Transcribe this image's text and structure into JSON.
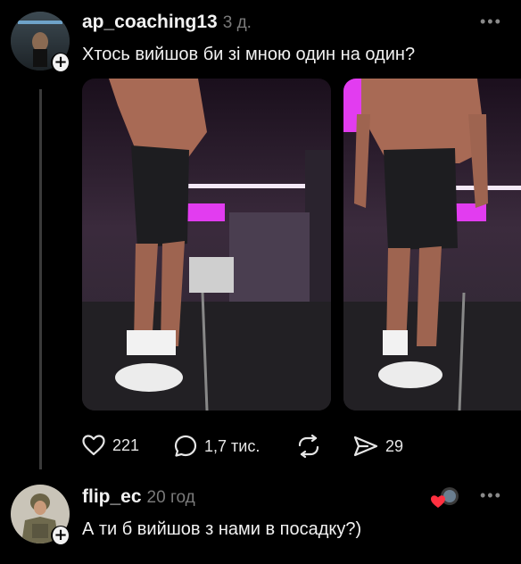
{
  "post": {
    "username": "ap_coaching13",
    "time": "3 д.",
    "text": "Хтось вийшов би зі мною один на один?",
    "more_icon": "more-horizontal-icon",
    "media": [
      "photo-1",
      "photo-2"
    ],
    "actions": {
      "likes": "221",
      "comments": "1,7 тис.",
      "repost_icon": "repost-icon",
      "shares": "29"
    }
  },
  "reply": {
    "username": "flip_ec",
    "time": "20 год",
    "text": "А ти б вийшов з нами в посадку?)",
    "liked_by_author_badge": "heart-avatar-icon",
    "more_icon": "more-horizontal-icon"
  },
  "colors": {
    "background": "#000000",
    "text": "#f2f2f2",
    "muted": "#7a7a7a",
    "like_red": "#ff3040",
    "neon_pink": "#e23cf0"
  }
}
